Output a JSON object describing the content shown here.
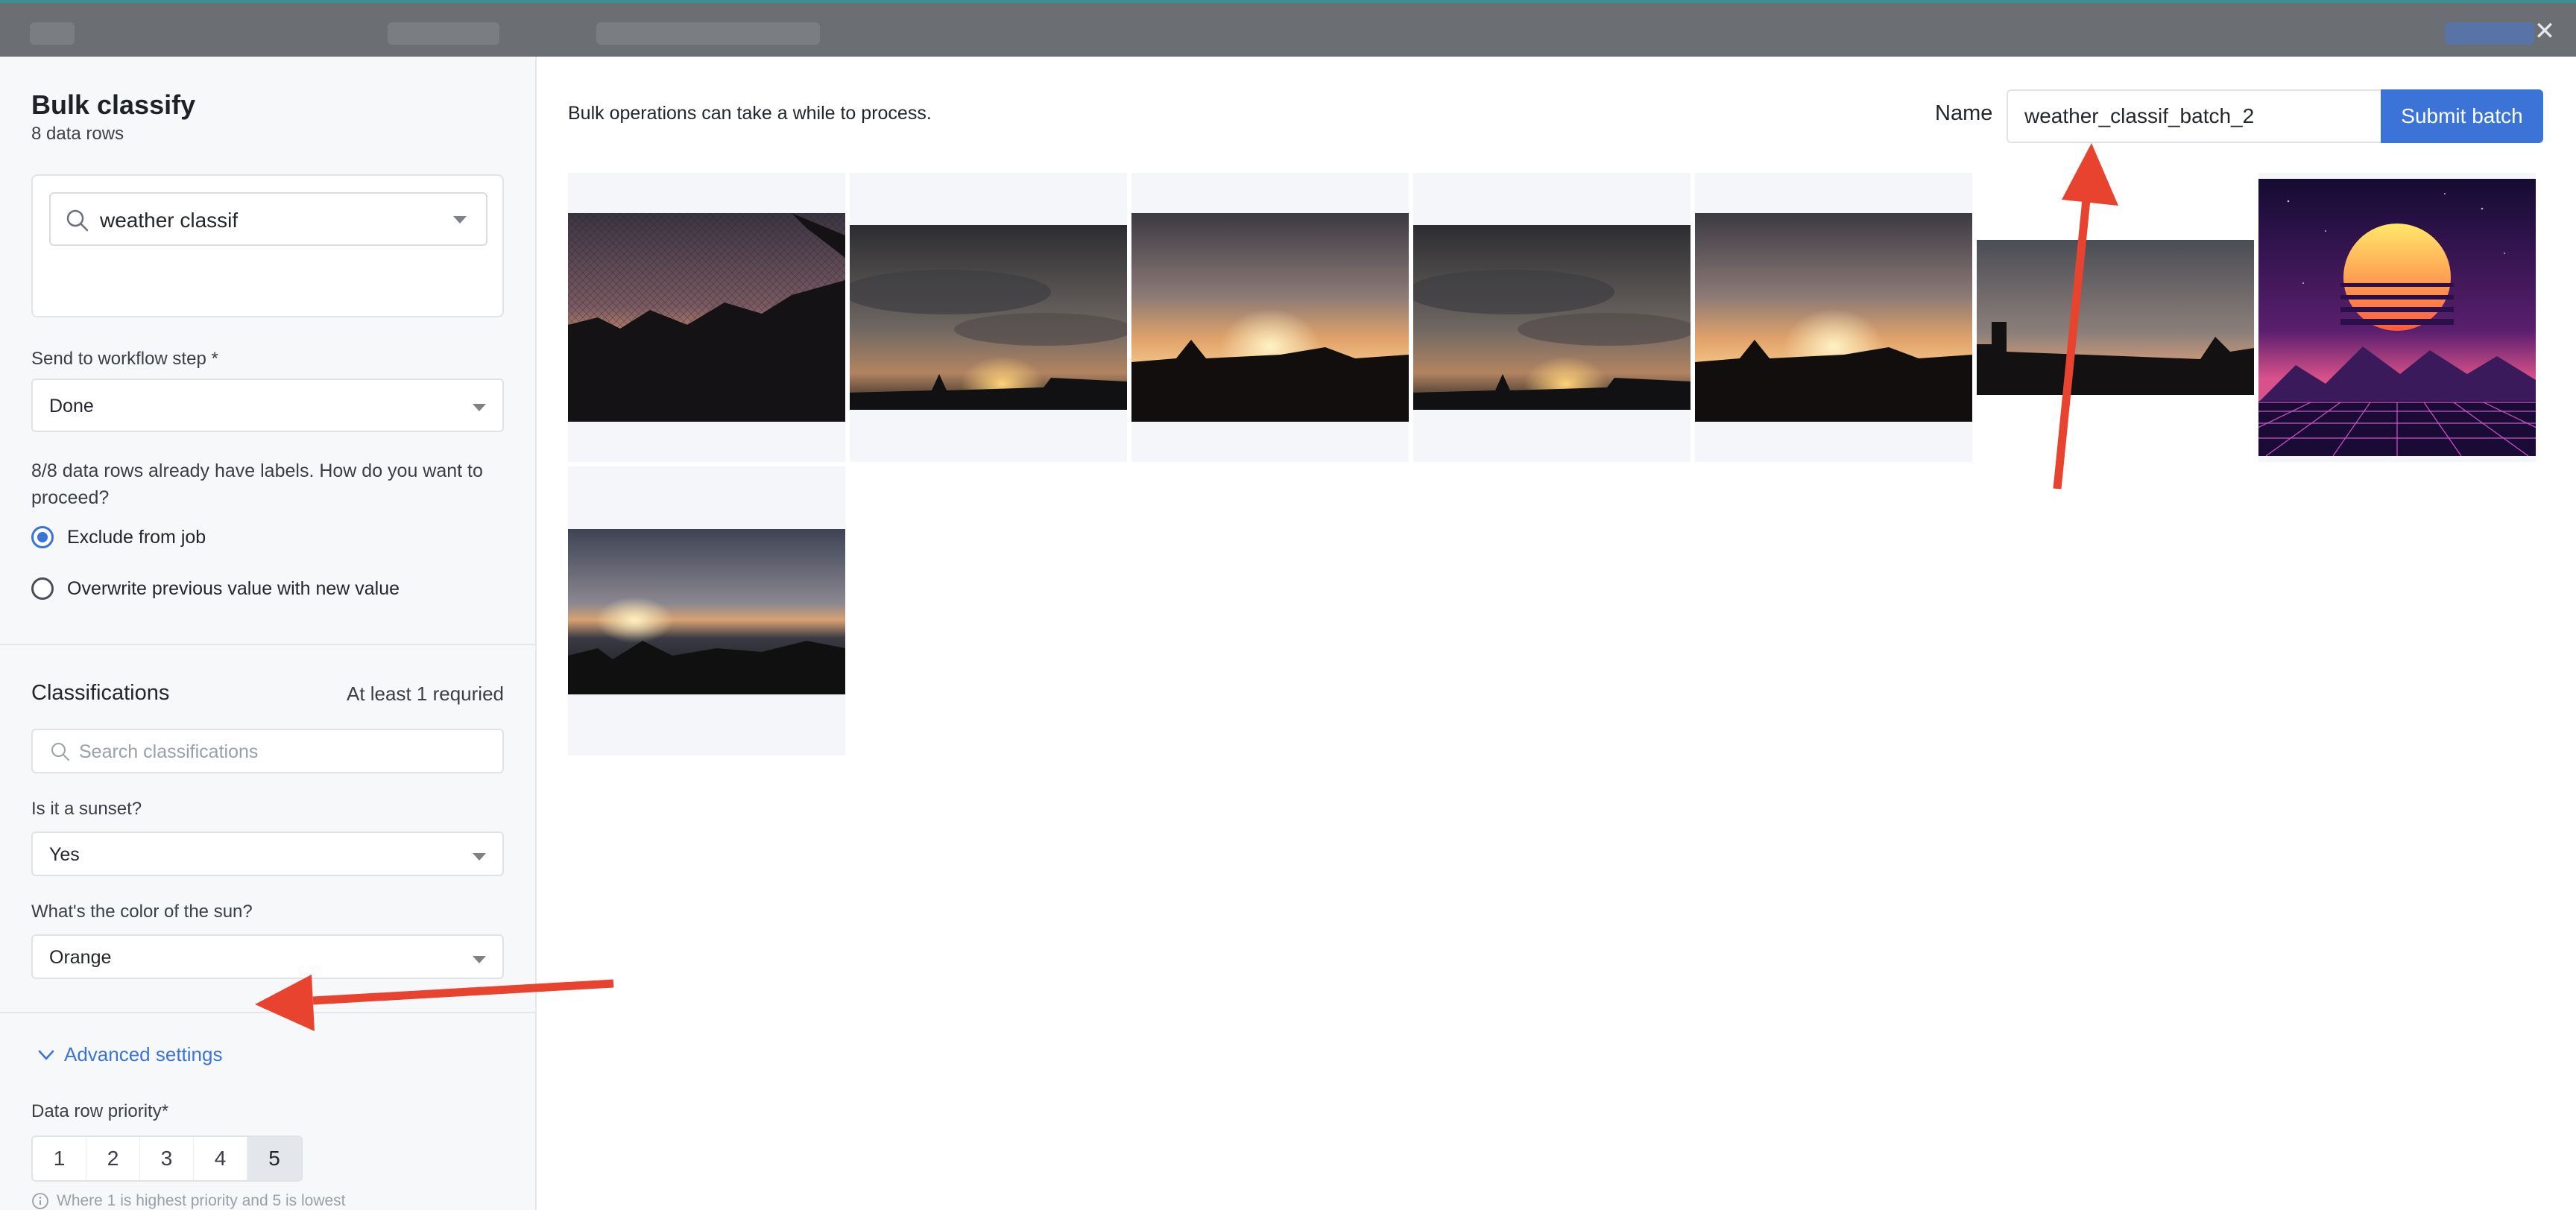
{
  "window": {
    "close_icon": "close-icon"
  },
  "sidebar": {
    "title": "Bulk classify",
    "subtitle": "8 data rows",
    "project_search": {
      "value": "weather classif",
      "icon": "search-icon"
    },
    "workflow": {
      "label": "Send to workflow step *",
      "value": "Done"
    },
    "labels_question": "8/8 data rows already have labels. How do you want to proceed?",
    "options": [
      {
        "label": "Exclude from job",
        "checked": true
      },
      {
        "label": "Overwrite previous value with new value",
        "checked": false
      }
    ],
    "classifications": {
      "title": "Classifications",
      "hint": "At least 1 requried",
      "search_placeholder": "Search classifications",
      "questions": [
        {
          "label": "Is it a sunset?",
          "value": "Yes"
        },
        {
          "label": "What's the color of the sun?",
          "value": "Orange"
        }
      ]
    },
    "advanced": {
      "toggle_label": "Advanced settings",
      "priority_label": "Data row priority*",
      "priority_options": [
        "1",
        "2",
        "3",
        "4",
        "5"
      ],
      "priority_selected": "5",
      "priority_note": "Where 1 is highest priority and 5 is lowest"
    }
  },
  "main": {
    "notice": "Bulk operations can take a while to process.",
    "name_label": "Name",
    "name_value": "weather_classif_batch_2",
    "submit_label": "Submit batch",
    "thumbnails": [
      {
        "scene": "sunset-through-net"
      },
      {
        "scene": "cloudy-sunset-rooftops"
      },
      {
        "scene": "sunset-silhouette-trees"
      },
      {
        "scene": "cloudy-sunset-rooftops"
      },
      {
        "scene": "sunset-silhouette-trees"
      },
      {
        "scene": "dusk-skyline"
      },
      {
        "scene": "synthwave-sun-grid"
      },
      {
        "scene": "sunset-over-sea"
      }
    ]
  },
  "colors": {
    "accent": "#3b74d6",
    "annotation_arrow": "#e8432f"
  }
}
